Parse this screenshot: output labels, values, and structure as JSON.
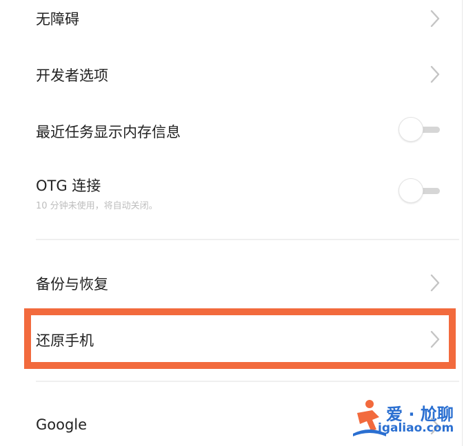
{
  "settings": {
    "items": [
      {
        "label": "无障碍",
        "control": "chevron-right-icon"
      },
      {
        "label": "开发者选项",
        "control": "chevron-right-icon"
      },
      {
        "label": "最近任务显示内存信息",
        "control": "toggle",
        "toggle_on": false
      },
      {
        "label": "OTG 连接",
        "subtitle": "10 分钟未使用，将自动关闭。",
        "control": "toggle",
        "toggle_on": false
      },
      {
        "label": "备份与恢复",
        "control": "chevron-right-icon"
      },
      {
        "label": "还原手机",
        "control": "chevron-right-icon",
        "highlighted": true
      },
      {
        "label": "Google",
        "control": "chevron-right-icon"
      }
    ]
  },
  "annotation": {
    "highlight_color": "#f26a3d"
  },
  "watermark": {
    "title": "爱 · 尬聊",
    "url": "igaliao.com",
    "color": "#2a6fd1"
  }
}
